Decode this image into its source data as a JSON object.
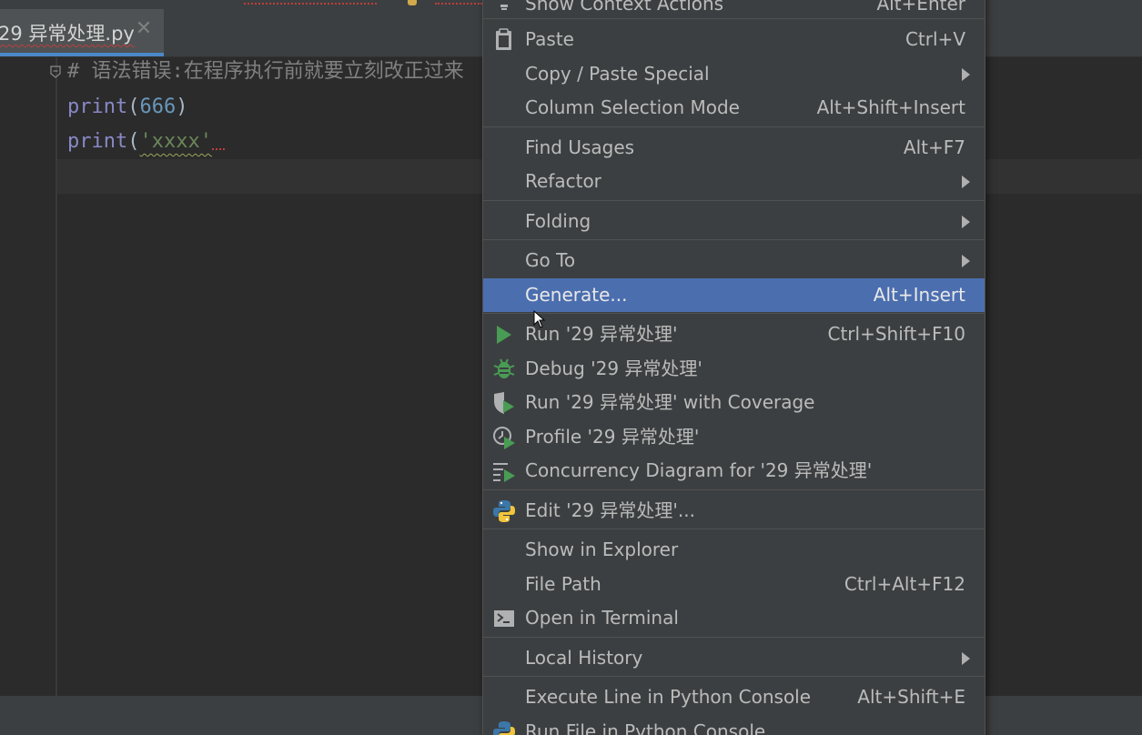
{
  "tab": {
    "file_name": "29 异常处理.py",
    "close_glyph": "✕"
  },
  "editor": {
    "line1_comment": "# 语法错误:在程序执行前就要立刻改正过来",
    "line2": {
      "fn": "print",
      "open": "(",
      "arg": "666",
      "close": ")"
    },
    "line3": {
      "fn": "print",
      "open": "(",
      "arg": "'xxxx'"
    }
  },
  "colors": {
    "menu_bg": "#3c3f41",
    "selected_bg": "#4b6eaf",
    "run_green": "#499c54",
    "editor_bg": "#2b2b2b"
  },
  "menu": {
    "items": [
      {
        "label": "Show Context Actions",
        "shortcut": "Alt+Enter",
        "icon": "lightbulb-icon"
      },
      {
        "label": "Paste",
        "shortcut": "Ctrl+V",
        "icon": "clipboard-icon"
      },
      {
        "label": "Copy / Paste Special",
        "shortcut": "",
        "submenu": true
      },
      {
        "label": "Column Selection Mode",
        "shortcut": "Alt+Shift+Insert"
      },
      {
        "label": "Find Usages",
        "shortcut": "Alt+F7"
      },
      {
        "label": "Refactor",
        "shortcut": "",
        "submenu": true
      },
      {
        "label": "Folding",
        "shortcut": "",
        "submenu": true
      },
      {
        "label": "Go To",
        "shortcut": "",
        "submenu": true
      },
      {
        "label": "Generate...",
        "shortcut": "Alt+Insert",
        "selected": true
      },
      {
        "label": "Run '29 异常处理'",
        "shortcut": "Ctrl+Shift+F10",
        "icon": "run-icon"
      },
      {
        "label": "Debug '29 异常处理'",
        "shortcut": "",
        "icon": "debug-bug-icon"
      },
      {
        "label": "Run '29 异常处理' with Coverage",
        "shortcut": "",
        "icon": "coverage-icon"
      },
      {
        "label": "Profile '29 异常处理'",
        "shortcut": "",
        "icon": "profile-icon"
      },
      {
        "label": "Concurrency Diagram for '29 异常处理'",
        "shortcut": "",
        "icon": "concurrency-icon"
      },
      {
        "label": "Edit '29 异常处理'...",
        "shortcut": "",
        "icon": "python-logo-icon"
      },
      {
        "label": "Show in Explorer",
        "shortcut": ""
      },
      {
        "label": "File Path",
        "shortcut": "Ctrl+Alt+F12"
      },
      {
        "label": "Open in Terminal",
        "shortcut": "",
        "icon": "terminal-icon"
      },
      {
        "label": "Local History",
        "shortcut": "",
        "submenu": true
      },
      {
        "label": "Execute Line in Python Console",
        "shortcut": "Alt+Shift+E"
      },
      {
        "label": "Run File in Python Console",
        "shortcut": "",
        "icon": "python-logo-icon"
      }
    ]
  }
}
